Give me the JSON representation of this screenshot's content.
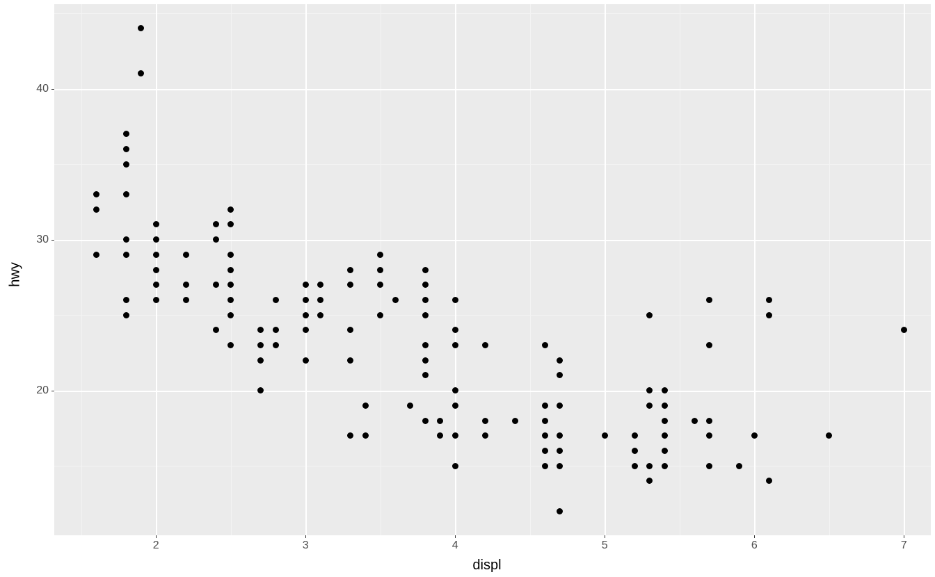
{
  "chart_data": {
    "type": "scatter",
    "xlabel": "displ",
    "ylabel": "hwy",
    "xlim": [
      1.32,
      7.18
    ],
    "ylim": [
      10.4,
      45.6
    ],
    "x_breaks": [
      2,
      3,
      4,
      5,
      6,
      7
    ],
    "y_breaks": [
      20,
      30,
      40
    ],
    "x_minor": [
      1.5,
      2.5,
      3.5,
      4.5,
      5.5,
      6.5
    ],
    "y_minor": [
      15,
      25,
      35,
      45
    ],
    "points": [
      [
        1.6,
        29
      ],
      [
        1.6,
        32
      ],
      [
        1.6,
        33
      ],
      [
        1.8,
        25
      ],
      [
        1.8,
        26
      ],
      [
        1.8,
        29
      ],
      [
        1.8,
        30
      ],
      [
        1.8,
        33
      ],
      [
        1.8,
        35
      ],
      [
        1.8,
        36
      ],
      [
        1.8,
        37
      ],
      [
        1.9,
        41
      ],
      [
        1.9,
        44
      ],
      [
        2.0,
        26
      ],
      [
        2.0,
        27
      ],
      [
        2.0,
        28
      ],
      [
        2.0,
        29
      ],
      [
        2.0,
        30
      ],
      [
        2.0,
        31
      ],
      [
        2.2,
        26
      ],
      [
        2.2,
        27
      ],
      [
        2.2,
        29
      ],
      [
        2.4,
        24
      ],
      [
        2.4,
        27
      ],
      [
        2.4,
        30
      ],
      [
        2.4,
        31
      ],
      [
        2.5,
        23
      ],
      [
        2.5,
        25
      ],
      [
        2.5,
        26
      ],
      [
        2.5,
        27
      ],
      [
        2.5,
        28
      ],
      [
        2.5,
        29
      ],
      [
        2.5,
        31
      ],
      [
        2.5,
        32
      ],
      [
        2.7,
        22
      ],
      [
        2.7,
        23
      ],
      [
        2.7,
        24
      ],
      [
        2.7,
        20
      ],
      [
        2.8,
        24
      ],
      [
        2.8,
        26
      ],
      [
        2.8,
        23
      ],
      [
        3.0,
        22
      ],
      [
        3.0,
        25
      ],
      [
        3.0,
        26
      ],
      [
        3.0,
        27
      ],
      [
        3.0,
        24
      ],
      [
        3.1,
        25
      ],
      [
        3.1,
        26
      ],
      [
        3.1,
        27
      ],
      [
        3.3,
        17
      ],
      [
        3.3,
        22
      ],
      [
        3.3,
        24
      ],
      [
        3.3,
        28
      ],
      [
        3.3,
        27
      ],
      [
        3.4,
        19
      ],
      [
        3.4,
        17
      ],
      [
        3.5,
        25
      ],
      [
        3.5,
        27
      ],
      [
        3.5,
        28
      ],
      [
        3.5,
        29
      ],
      [
        3.6,
        26
      ],
      [
        3.7,
        19
      ],
      [
        3.8,
        21
      ],
      [
        3.8,
        22
      ],
      [
        3.8,
        23
      ],
      [
        3.8,
        25
      ],
      [
        3.8,
        26
      ],
      [
        3.8,
        27
      ],
      [
        3.8,
        28
      ],
      [
        3.8,
        18
      ],
      [
        3.9,
        17
      ],
      [
        3.9,
        18
      ],
      [
        4.0,
        15
      ],
      [
        4.0,
        17
      ],
      [
        4.0,
        19
      ],
      [
        4.0,
        20
      ],
      [
        4.0,
        23
      ],
      [
        4.0,
        24
      ],
      [
        4.0,
        26
      ],
      [
        4.2,
        17
      ],
      [
        4.2,
        18
      ],
      [
        4.2,
        23
      ],
      [
        4.4,
        18
      ],
      [
        4.6,
        15
      ],
      [
        4.6,
        16
      ],
      [
        4.6,
        17
      ],
      [
        4.6,
        18
      ],
      [
        4.6,
        19
      ],
      [
        4.6,
        23
      ],
      [
        4.7,
        12
      ],
      [
        4.7,
        15
      ],
      [
        4.7,
        16
      ],
      [
        4.7,
        17
      ],
      [
        4.7,
        19
      ],
      [
        4.7,
        21
      ],
      [
        4.7,
        22
      ],
      [
        5.0,
        17
      ],
      [
        5.2,
        15
      ],
      [
        5.2,
        16
      ],
      [
        5.2,
        17
      ],
      [
        5.3,
        14
      ],
      [
        5.3,
        15
      ],
      [
        5.3,
        19
      ],
      [
        5.3,
        20
      ],
      [
        5.3,
        25
      ],
      [
        5.4,
        15
      ],
      [
        5.4,
        16
      ],
      [
        5.4,
        17
      ],
      [
        5.4,
        18
      ],
      [
        5.4,
        19
      ],
      [
        5.4,
        20
      ],
      [
        5.6,
        18
      ],
      [
        5.7,
        17
      ],
      [
        5.7,
        18
      ],
      [
        5.7,
        26
      ],
      [
        5.7,
        23
      ],
      [
        5.7,
        15
      ],
      [
        5.9,
        15
      ],
      [
        6.0,
        17
      ],
      [
        6.1,
        14
      ],
      [
        6.1,
        25
      ],
      [
        6.1,
        26
      ],
      [
        6.5,
        17
      ],
      [
        7.0,
        24
      ]
    ]
  }
}
